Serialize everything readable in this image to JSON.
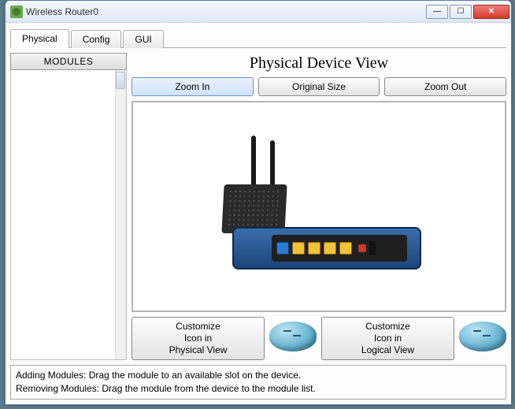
{
  "window": {
    "title": "Wireless Router0"
  },
  "tabs": [
    {
      "label": "Physical",
      "active": true
    },
    {
      "label": "Config",
      "active": false
    },
    {
      "label": "GUI",
      "active": false
    }
  ],
  "sidebar": {
    "header": "MODULES"
  },
  "main": {
    "heading": "Physical Device View",
    "zoom": {
      "in": "Zoom In",
      "original": "Original Size",
      "out": "Zoom Out"
    },
    "customize": {
      "physical": "Customize\nIcon in\nPhysical View",
      "logical": "Customize\nIcon in\nLogical View"
    }
  },
  "help": {
    "line1": "Adding Modules: Drag the module to an available slot on the device.",
    "line2": "Removing Modules: Drag the module from the device to the module list."
  },
  "icons": {
    "minimize": "—",
    "maximize": "☐",
    "close": "✕"
  }
}
